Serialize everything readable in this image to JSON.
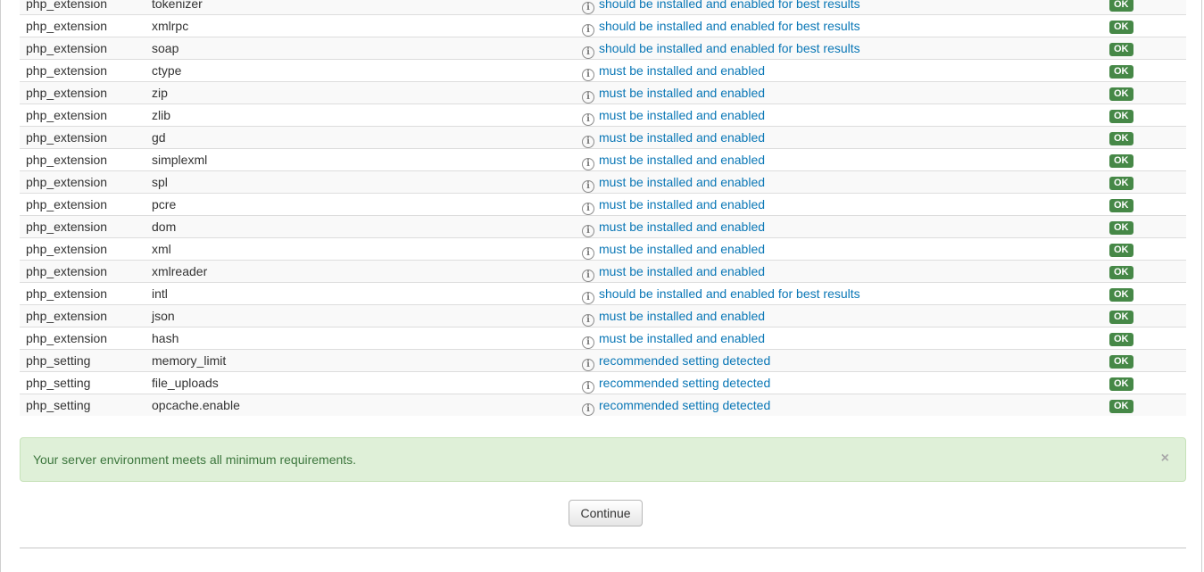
{
  "requirements": [
    {
      "type": "php_extension",
      "name": "tokenizer",
      "message": "should be installed and enabled for best results",
      "status": "OK"
    },
    {
      "type": "php_extension",
      "name": "xmlrpc",
      "message": "should be installed and enabled for best results",
      "status": "OK"
    },
    {
      "type": "php_extension",
      "name": "soap",
      "message": "should be installed and enabled for best results",
      "status": "OK"
    },
    {
      "type": "php_extension",
      "name": "ctype",
      "message": "must be installed and enabled",
      "status": "OK"
    },
    {
      "type": "php_extension",
      "name": "zip",
      "message": "must be installed and enabled",
      "status": "OK"
    },
    {
      "type": "php_extension",
      "name": "zlib",
      "message": "must be installed and enabled",
      "status": "OK"
    },
    {
      "type": "php_extension",
      "name": "gd",
      "message": "must be installed and enabled",
      "status": "OK"
    },
    {
      "type": "php_extension",
      "name": "simplexml",
      "message": "must be installed and enabled",
      "status": "OK"
    },
    {
      "type": "php_extension",
      "name": "spl",
      "message": "must be installed and enabled",
      "status": "OK"
    },
    {
      "type": "php_extension",
      "name": "pcre",
      "message": "must be installed and enabled",
      "status": "OK"
    },
    {
      "type": "php_extension",
      "name": "dom",
      "message": "must be installed and enabled",
      "status": "OK"
    },
    {
      "type": "php_extension",
      "name": "xml",
      "message": "must be installed and enabled",
      "status": "OK"
    },
    {
      "type": "php_extension",
      "name": "xmlreader",
      "message": "must be installed and enabled",
      "status": "OK"
    },
    {
      "type": "php_extension",
      "name": "intl",
      "message": "should be installed and enabled for best results",
      "status": "OK"
    },
    {
      "type": "php_extension",
      "name": "json",
      "message": "must be installed and enabled",
      "status": "OK"
    },
    {
      "type": "php_extension",
      "name": "hash",
      "message": "must be installed and enabled",
      "status": "OK"
    },
    {
      "type": "php_setting",
      "name": "memory_limit",
      "message": "recommended setting detected",
      "status": "OK"
    },
    {
      "type": "php_setting",
      "name": "file_uploads",
      "message": "recommended setting detected",
      "status": "OK"
    },
    {
      "type": "php_setting",
      "name": "opcache.enable",
      "message": "recommended setting detected",
      "status": "OK"
    }
  ],
  "alert": {
    "text": "Your server environment meets all minimum requirements.",
    "close": "×"
  },
  "continue_label": "Continue",
  "icons": {
    "info": "info-circle-icon",
    "close": "close-icon"
  },
  "colors": {
    "link": "#0a77b6",
    "ok_badge": "#468847",
    "alert_bg": "#dff0d8",
    "alert_text": "#3c763d"
  }
}
